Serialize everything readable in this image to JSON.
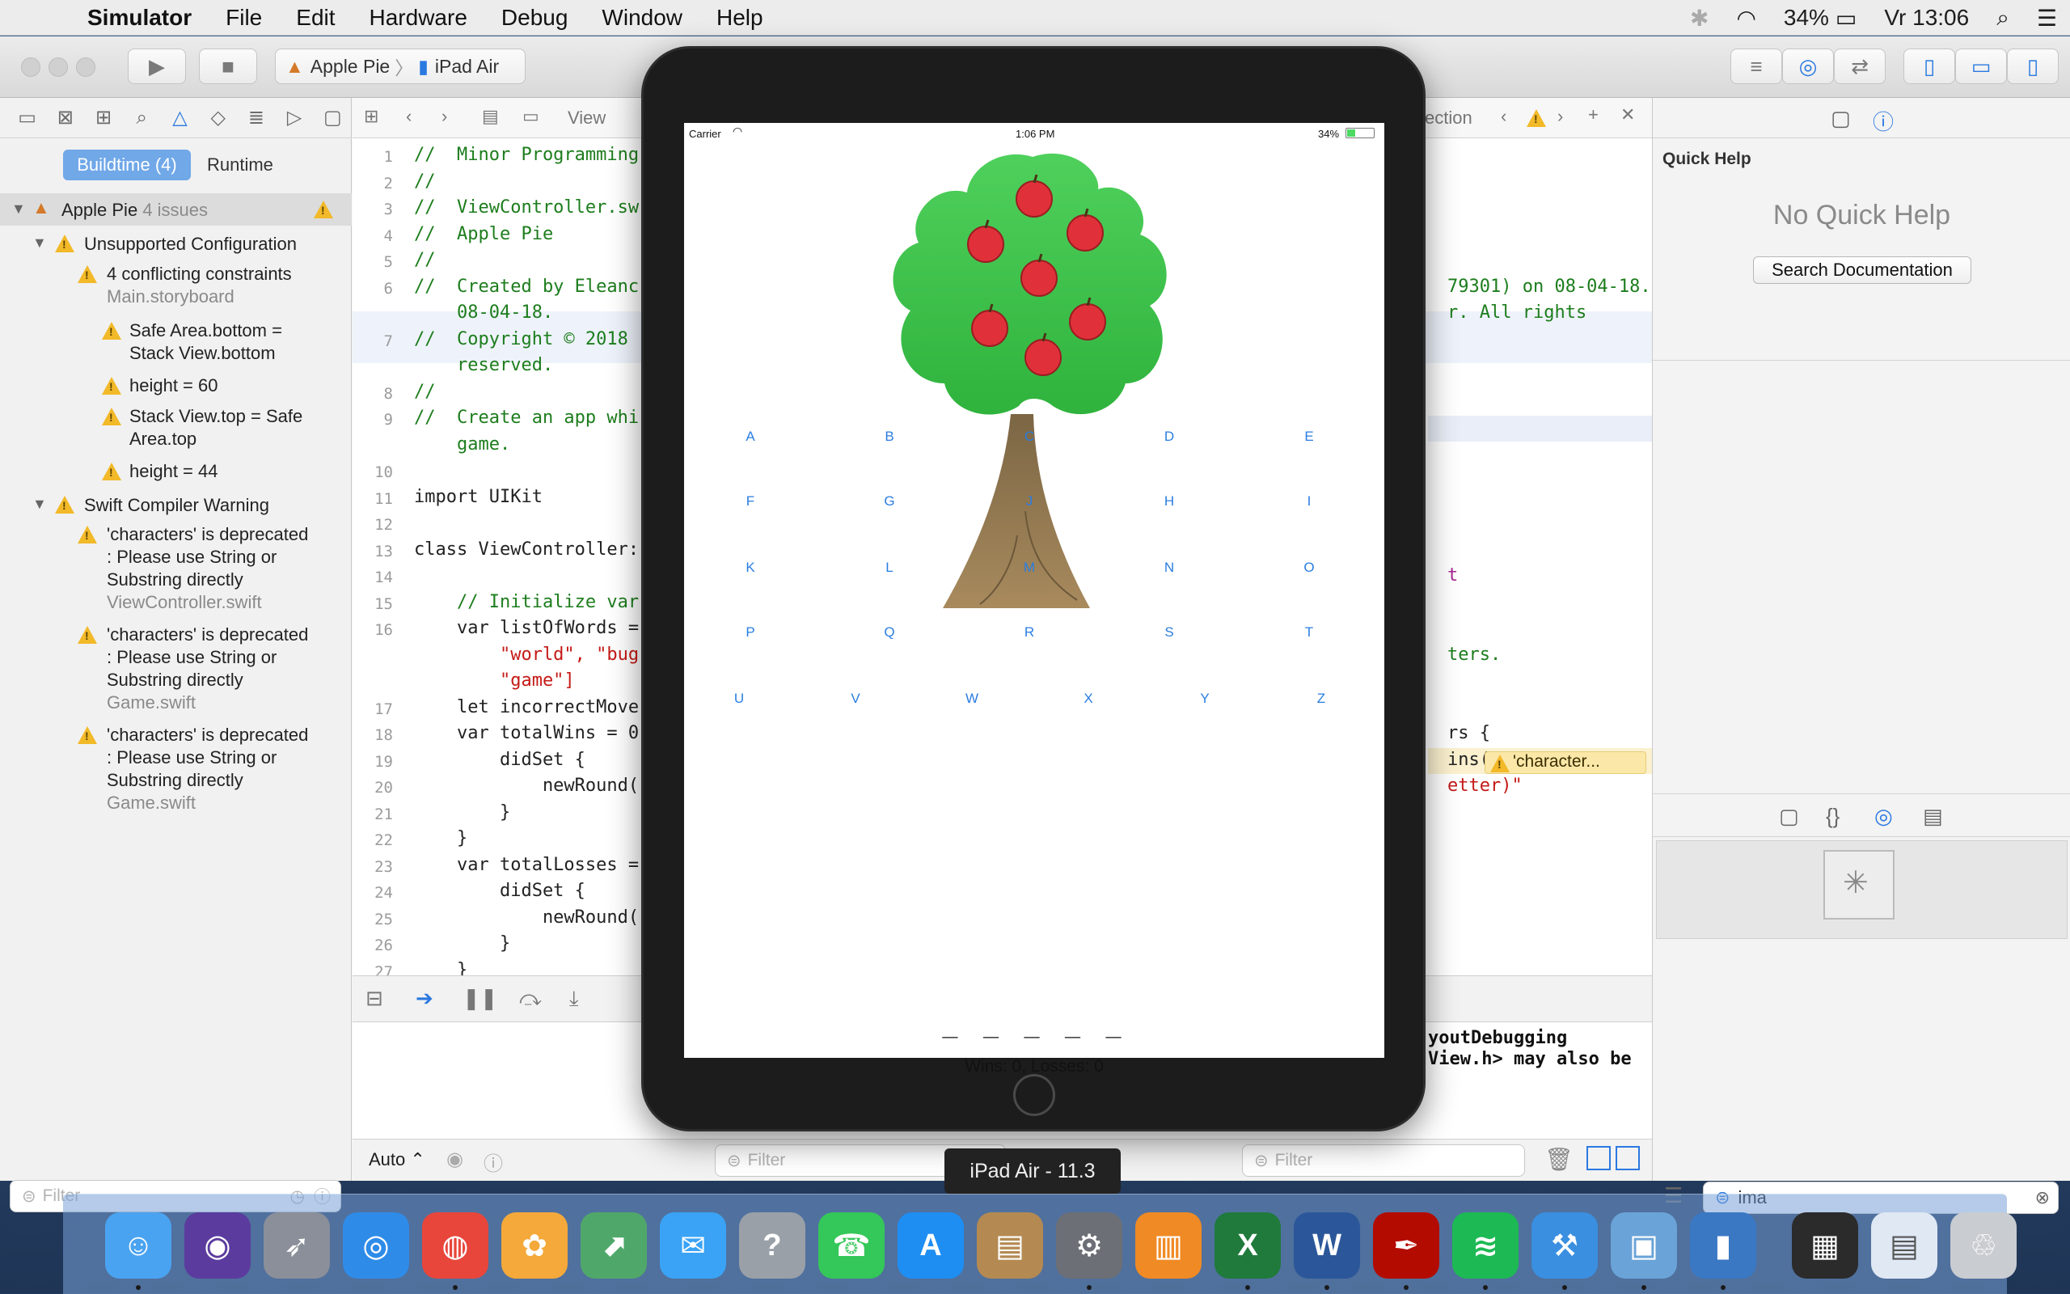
{
  "menubar": {
    "app": "Simulator",
    "items": [
      "File",
      "Edit",
      "Hardware",
      "Debug",
      "Window",
      "Help"
    ],
    "battery": "34%",
    "clock": "Vr 13:06"
  },
  "toolbar": {
    "scheme": "Apple Pie",
    "device": "iPad Air"
  },
  "navigator": {
    "tabs": [
      "Buildtime (4)",
      "Runtime"
    ],
    "project": "Apple Pie",
    "project_count": "4 issues",
    "group1": "Unsupported Configuration",
    "g1_items": [
      {
        "title": "4 conflicting constraints",
        "sub": "Main.storyboard"
      },
      {
        "title": "Safe Area.bottom =",
        "title2": "Stack View.bottom"
      },
      {
        "title": "height = 60"
      },
      {
        "title": "Stack View.top = Safe",
        "title2": "Area.top"
      },
      {
        "title": "height = 44"
      }
    ],
    "group2": "Swift Compiler Warning",
    "g2_items": [
      {
        "l1": "'characters' is deprecated",
        "l2": ": Please use String or",
        "l3": "Substring directly",
        "file": "ViewController.swift"
      },
      {
        "l1": "'characters' is deprecated",
        "l2": ": Please use String or",
        "l3": "Substring directly",
        "file": "Game.swift"
      },
      {
        "l1": "'characters' is deprecated",
        "l2": ": Please use String or",
        "l3": "Substring directly",
        "file": "Game.swift"
      }
    ],
    "filter_placeholder": "Filter"
  },
  "editor": {
    "jump_file": "View",
    "jump_right": "ection",
    "lines": [
      {
        "n": "1",
        "code": "//  Minor Programming",
        "cls": "c"
      },
      {
        "n": "2",
        "code": "//",
        "cls": "c"
      },
      {
        "n": "3",
        "code": "//  ViewController.sw",
        "cls": "c"
      },
      {
        "n": "4",
        "code": "//  Apple Pie",
        "cls": "c"
      },
      {
        "n": "5",
        "code": "//",
        "cls": "c"
      },
      {
        "n": "6",
        "code": "//  Created by Eleanc",
        "cls": "c"
      },
      {
        "n": "",
        "code": "    08-04-18.",
        "cls": "c"
      },
      {
        "n": "7",
        "code": "//  Copyright © 2018",
        "cls": "c"
      },
      {
        "n": "",
        "code": "    reserved.",
        "cls": "c"
      },
      {
        "n": "8",
        "code": "//",
        "cls": "c"
      },
      {
        "n": "9",
        "code": "//  Create an app whi",
        "cls": "c"
      },
      {
        "n": "",
        "code": "    game.",
        "cls": "c"
      },
      {
        "n": "10",
        "code": "",
        "cls": "t"
      },
      {
        "n": "11",
        "code": "import UIKit",
        "cls": "t"
      },
      {
        "n": "12",
        "code": "",
        "cls": "t"
      },
      {
        "n": "13",
        "code": "class ViewController:",
        "cls": "t"
      },
      {
        "n": "14",
        "code": "",
        "cls": "t"
      },
      {
        "n": "15",
        "code": "    // Initialize var",
        "cls": "c"
      },
      {
        "n": "16",
        "code": "    var listOfWords =",
        "cls": "t"
      },
      {
        "n": "",
        "code": "        \"world\", \"bug",
        "cls": "s"
      },
      {
        "n": "",
        "code": "        \"game\"]",
        "cls": "s"
      },
      {
        "n": "17",
        "code": "    let incorrectMove",
        "cls": "t"
      },
      {
        "n": "18",
        "code": "    var totalWins = 0",
        "cls": "t"
      },
      {
        "n": "19",
        "code": "        didSet {",
        "cls": "t"
      },
      {
        "n": "20",
        "code": "            newRound(",
        "cls": "t"
      },
      {
        "n": "21",
        "code": "        }",
        "cls": "t"
      },
      {
        "n": "22",
        "code": "    }",
        "cls": "t"
      },
      {
        "n": "23",
        "code": "    var totalLosses =",
        "cls": "t"
      },
      {
        "n": "24",
        "code": "        didSet {",
        "cls": "t"
      },
      {
        "n": "25",
        "code": "            newRound(",
        "cls": "t"
      },
      {
        "n": "26",
        "code": "        }",
        "cls": "t"
      },
      {
        "n": "27",
        "code": "    }",
        "cls": "t"
      }
    ],
    "right_fragments": [
      {
        "row": 5,
        "text": "79301) on 08-04-18.",
        "cls": "c"
      },
      {
        "row": 6,
        "text": "r. All rights",
        "cls": "c"
      },
      {
        "row": 16,
        "text": "t",
        "cls": "k"
      },
      {
        "row": 19,
        "text": "ters.",
        "cls": "c"
      },
      {
        "row": 22,
        "text": "rs {",
        "cls": "t"
      },
      {
        "row": 23,
        "text": "ins(letter) {",
        "cls": "t"
      },
      {
        "row": 24,
        "text": "etter)\"",
        "cls": "s"
      }
    ],
    "warning_badge": "'character...",
    "console_lines": [
      "youtDebugging",
      "View.h> may also be"
    ],
    "auto_label": "Auto",
    "filter_placeholder": "Filter"
  },
  "inspector": {
    "quick_help_title": "Quick Help",
    "no_quick_help": "No Quick Help",
    "search_button": "Search Documentation",
    "filter_value": "ima"
  },
  "simulator": {
    "carrier": "Carrier",
    "time": "1:06 PM",
    "battery": "34%",
    "letters": [
      "A",
      "B",
      "C",
      "D",
      "E",
      "F",
      "G",
      "J",
      "H",
      "I",
      "K",
      "L",
      "M",
      "N",
      "O",
      "P",
      "Q",
      "R",
      "S",
      "T",
      "U",
      "V",
      "W",
      "X",
      "Y",
      "Z"
    ],
    "word": "_ _ _ _ _",
    "score": "Wins: 0, Losses: 0",
    "tooltip": "iPad Air - 11.3",
    "apple_count": 7
  },
  "dock": {
    "apps": [
      "Finder",
      "Siri",
      "Launchpad",
      "Safari",
      "Chrome",
      "Photos",
      "Maps",
      "Messages",
      "Help",
      "FaceTime",
      "App Store",
      "Contacts",
      "System Preferences",
      "iBooks",
      "Excel",
      "Word",
      "Acrobat",
      "Spotify",
      "Xcode",
      "Preview",
      "Simulator",
      "Screenshot",
      "Documents",
      "Trash"
    ],
    "colors": {
      "finder": "#4aa3f0",
      "excel": "#1f7a3c",
      "word": "#2b579a",
      "acrobat": "#b30b00",
      "spotify": "#1db954",
      "chrome": "#e8463b"
    }
  }
}
